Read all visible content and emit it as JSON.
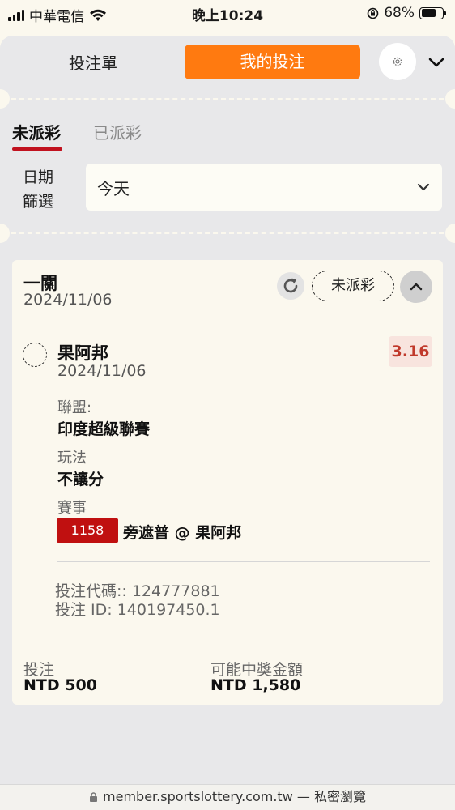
{
  "status_bar": {
    "carrier": "中華電信",
    "time": "晚上10:24",
    "battery_percent": "68%",
    "battery_level": 0.68
  },
  "header": {
    "tab_betslip": "投注單",
    "tab_mybets": "我的投注",
    "accent_color": "#ff7a10"
  },
  "filters": {
    "tab_unsettled": "未派彩",
    "tab_settled": "已派彩",
    "date_label": "日期篩選",
    "date_value": "今天"
  },
  "bet": {
    "type": "一關",
    "date": "2024/11/06",
    "status": "未派彩",
    "selection": {
      "team": "果阿邦",
      "date": "2024/11/06",
      "odds": "3.16"
    },
    "league_label": "聯盟:",
    "league_value": "印度超級聯賽",
    "market_label": "玩法",
    "market_value": "不讓分",
    "event_label": "賽事",
    "event_no": "1158",
    "event_name": "旁遮普 @ 果阿邦",
    "bet_code": "投注代碼:: 124777881",
    "bet_id": "投注 ID: 140197450.1",
    "stake_label": "投注",
    "stake_value": "NTD 500",
    "payout_label": "可能中獎金額",
    "payout_value": "NTD 1,580"
  },
  "browser": {
    "url": "member.sportslottery.com.tw",
    "mode": "— 私密瀏覽"
  }
}
